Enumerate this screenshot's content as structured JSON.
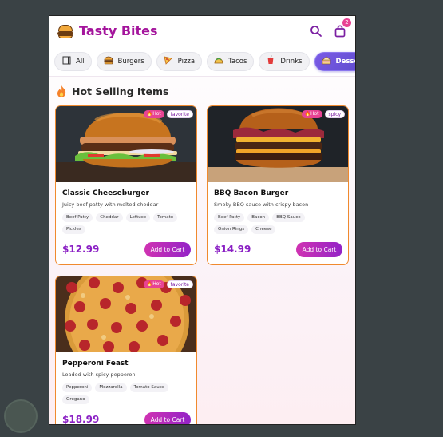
{
  "header": {
    "brand": "Tasty Bites",
    "search_icon": "search-icon",
    "cart_icon": "bag-icon",
    "cart_count": "2"
  },
  "categories": [
    {
      "label": "All",
      "icon": "grid-icon",
      "active": false
    },
    {
      "label": "Burgers",
      "icon": "burger-icon",
      "active": false
    },
    {
      "label": "Pizza",
      "icon": "pizza-icon",
      "active": false
    },
    {
      "label": "Tacos",
      "icon": "taco-icon",
      "active": false
    },
    {
      "label": "Drinks",
      "icon": "drink-icon",
      "active": false
    },
    {
      "label": "Desserts",
      "icon": "cake-icon",
      "active": true
    }
  ],
  "section": {
    "title": "Hot Selling Items",
    "icon": "fire-icon"
  },
  "items": [
    {
      "name": "Classic Cheeseburger",
      "desc": "Juicy beef patty with melted cheddar",
      "price": "$12.99",
      "hot": "Hot",
      "badge": "favorite",
      "tags": [
        "Beef Patty",
        "Cheddar",
        "Lettuce",
        "Tomato",
        "Pickles"
      ],
      "cta": "Add to Cart"
    },
    {
      "name": "BBQ Bacon Burger",
      "desc": "Smoky BBQ sauce with crispy bacon",
      "price": "$14.99",
      "hot": "Hot",
      "badge": "spicy",
      "tags": [
        "Beef Patty",
        "Bacon",
        "BBQ Sauce",
        "Onion Rings",
        "Cheese"
      ],
      "cta": "Add to Cart"
    },
    {
      "name": "Pepperoni Feast",
      "desc": "Loaded with spicy pepperoni",
      "price": "$18.99",
      "hot": "Hot",
      "badge": "favorite",
      "tags": [
        "Pepperoni",
        "Mozzarella",
        "Tomato Sauce",
        "Oregano"
      ],
      "cta": "Add to Cart"
    }
  ],
  "colors": {
    "brand": "#a4149c",
    "accent": "#9323c7",
    "active_category": "#5a48c9",
    "card_border": "#f08a2e"
  }
}
